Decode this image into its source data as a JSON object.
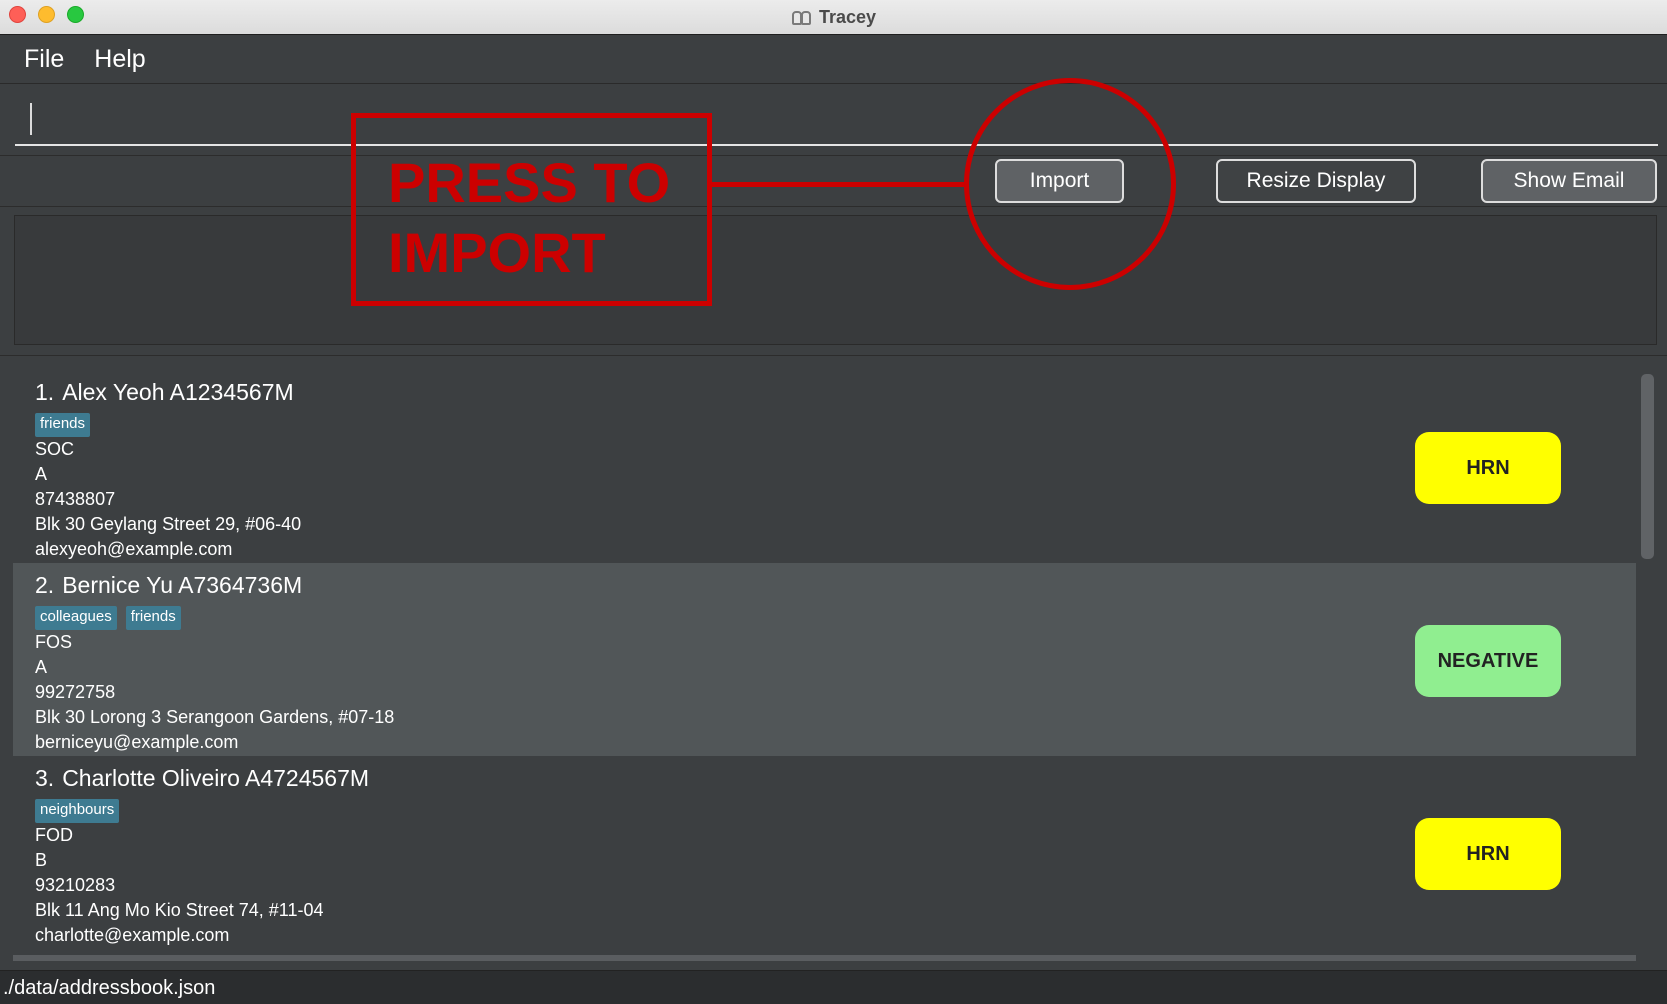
{
  "window": {
    "title": "Tracey"
  },
  "menu": {
    "items": [
      "File",
      "Help"
    ]
  },
  "command": {
    "value": "",
    "placeholder": ""
  },
  "toolbar": {
    "import_label": "Import",
    "resize_label": "Resize Display",
    "email_label": "Show Email"
  },
  "result": {
    "text": ""
  },
  "annotation": {
    "line1": "PRESS TO",
    "line2": "IMPORT",
    "color": "#cc0000"
  },
  "persons": [
    {
      "index": "1.",
      "name": "Alex Yeoh A1234567M",
      "tags": [
        "friends"
      ],
      "faculty": "SOC",
      "block": "A",
      "phone": "87438807",
      "address": "Blk 30 Geylang Street 29, #06-40",
      "email": "alexyeoh@example.com",
      "status": "HRN"
    },
    {
      "index": "2.",
      "name": "Bernice Yu A7364736M",
      "tags": [
        "colleagues",
        "friends"
      ],
      "faculty": "FOS",
      "block": "A",
      "phone": "99272758",
      "address": "Blk 30 Lorong 3 Serangoon Gardens, #07-18",
      "email": "berniceyu@example.com",
      "status": "NEGATIVE"
    },
    {
      "index": "3.",
      "name": "Charlotte Oliveiro A4724567M",
      "tags": [
        "neighbours"
      ],
      "faculty": "FOD",
      "block": "B",
      "phone": "93210283",
      "address": "Blk 11 Ang Mo Kio Street 74, #11-04",
      "email": "charlotte@example.com",
      "status": "HRN"
    }
  ],
  "status_colors": {
    "HRN": "#ffff00",
    "NEGATIVE": "#90ee90"
  },
  "statusbar": {
    "path": "./data/addressbook.json"
  }
}
